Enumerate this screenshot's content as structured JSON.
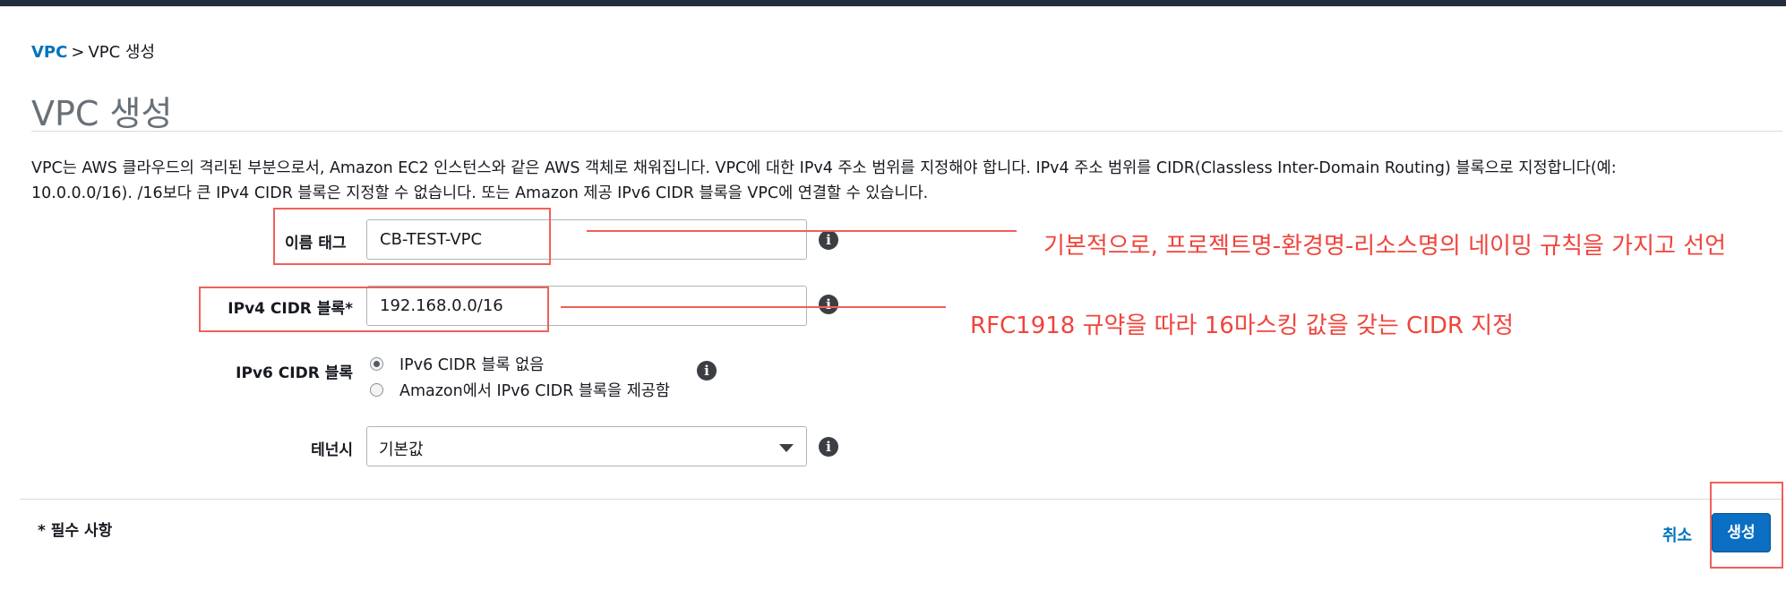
{
  "breadcrumb": {
    "root": "VPC",
    "separator": ">",
    "current": "VPC 생성"
  },
  "page": {
    "title": "VPC 생성",
    "description": "VPC는 AWS 클라우드의 격리된 부분으로서, Amazon EC2 인스턴스와 같은 AWS 객체로 채워집니다. VPC에 대한 IPv4 주소 범위를 지정해야 합니다. IPv4 주소 범위를 CIDR(Classless Inter-Domain Routing) 블록으로 지정합니다(예: 10.0.0.0/16). /16보다 큰 IPv4 CIDR 블록은 지정할 수 없습니다. 또는 Amazon 제공 IPv6 CIDR 블록을 VPC에 연결할 수 있습니다."
  },
  "form": {
    "name_tag": {
      "label": "이름 태그",
      "value": "CB-TEST-VPC"
    },
    "ipv4_cidr": {
      "label": "IPv4 CIDR 블록*",
      "value": "192.168.0.0/16"
    },
    "ipv6_cidr": {
      "label": "IPv6 CIDR 블록",
      "options": [
        "IPv6 CIDR 블록 없음",
        "Amazon에서 IPv6 CIDR 블록을 제공함"
      ],
      "selected_index": 0
    },
    "tenancy": {
      "label": "테넌시",
      "value": "기본값"
    }
  },
  "info_icon_glyph": "i",
  "footer": {
    "required_note": "* 필수 사항",
    "cancel_label": "취소",
    "create_label": "생성"
  },
  "annotations": [
    {
      "target": "name_tag",
      "text": "기본적으로, 프로젝트명-환경명-리소스명의 네이밍 규칙을 가지고 선언"
    },
    {
      "target": "ipv4_cidr",
      "text": "RFC1918 규약을 따라 16마스킹 값을 갖는 CIDR 지정"
    }
  ],
  "colors": {
    "link": "#0073bb",
    "primary_button": "#0a6fc2",
    "annotation": "#f0443c",
    "top_bar": "#232f3e"
  },
  "icons": [
    "info-icon",
    "chevron-down-icon",
    "radio-button"
  ]
}
